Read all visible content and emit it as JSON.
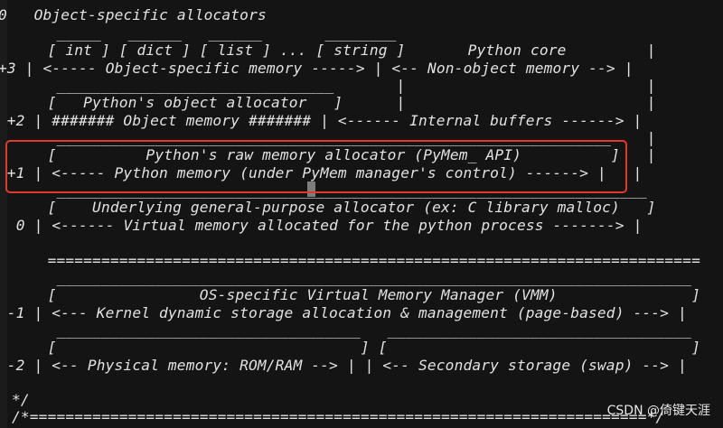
{
  "editor": {
    "lines": [
      "0   Object-specific allocators",
      "     _____   ______   ______       ________",
      "    [ int ] [ dict ] [ list ] ... [ string ]       Python core         |",
      "+3 | <----- Object-specific memory -----> | <-- Non-object memory --> |",
      "     _______________________________       |                           |",
      "    [   Python's object allocator   ]      |                           |",
      "5 +2 | ####### Object memory ####### | <------ Internal buffers ------> |",
      "     ______________________________________________________________    |",
      "    [          Python's raw memory allocator (PyMem_ API)          ]   |",
      "0 +1 | <----- Python memory (under PyMem manager's control) ------> |   |",
      "     __________________________________________________________________",
      "    [    Underlying general-purpose allocator (ex: C library malloc)   ]",
      "  0 | <------ Virtual memory allocated for the python process -------> |",
      "",
      "    =========================================================================",
      "     _______________________________________________________________________",
      "    [                OS-specific Virtual Memory Manager (VMM)               ]",
      "  -1 | <--- Kernel dynamic storage allocation & management (page-based) ---> |",
      "     __________________________________   __________________________________",
      "    [                                  ] [                                  ]",
      "  -2 | <-- Physical memory: ROM/RAM --> | | <-- Secondary storage (swap) --> |",
      "",
      "*/",
      "/*=====================================================================*/"
    ]
  },
  "watermark": {
    "text": "CSDN @倚键天涯"
  },
  "highlight": {
    "color": "#e23a2a"
  }
}
